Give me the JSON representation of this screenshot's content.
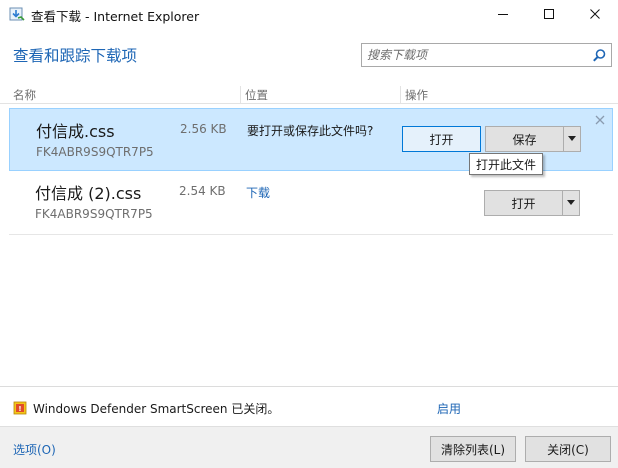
{
  "window": {
    "title": "查看下载 - Internet Explorer"
  },
  "header": {
    "title": "查看和跟踪下载项",
    "search_placeholder": "搜索下载项"
  },
  "columns": {
    "name": "名称",
    "location": "位置",
    "actions": "操作"
  },
  "downloads": [
    {
      "filename": "付信成.css",
      "size": "2.56 KB",
      "source": "FK4ABR9S9QTR7P5",
      "status": "要打开或保存此文件吗?",
      "open_label": "打开",
      "save_label": "保存"
    },
    {
      "filename": "付信成 (2).css",
      "size": "2.54 KB",
      "source": "FK4ABR9S9QTR7P5",
      "status": "下载",
      "open_label": "打开"
    }
  ],
  "tooltip": "打开此文件",
  "smartscreen": {
    "message": "Windows Defender SmartScreen 已关闭。",
    "enable_label": "启用"
  },
  "footer": {
    "options_label": "选项(O)",
    "clear_list_label": "清除列表(L)",
    "close_label": "关闭(C)"
  },
  "colors": {
    "accent": "#1e66b5",
    "selection": "#cce8ff",
    "selection_border": "#99d1ff"
  }
}
